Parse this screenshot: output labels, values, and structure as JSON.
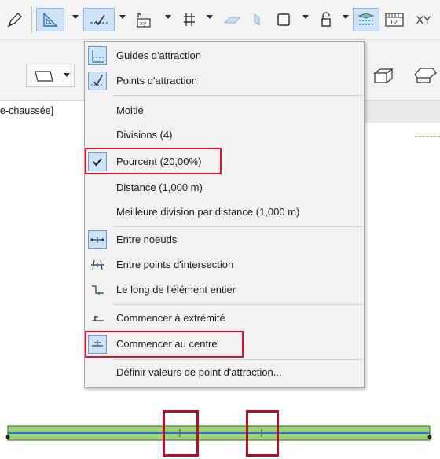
{
  "story_label": "e-chaussée]",
  "menu": {
    "items": [
      {
        "label": "Guides d'attraction",
        "icon": "attraction-guides-icon"
      },
      {
        "label": "Points d'attraction",
        "icon": "attraction-points-icon"
      },
      {
        "label": "Moitié"
      },
      {
        "label": "Divisions (4)"
      },
      {
        "label": "Pourcent (20,00%)",
        "checked": true
      },
      {
        "label": "Distance (1,000 m)"
      },
      {
        "label": "Meilleure division par distance (1,000 m)"
      },
      {
        "label": "Entre noeuds",
        "icon": "between-nodes-icon"
      },
      {
        "label": "Entre points d'intersection",
        "icon": "between-intersections-icon"
      },
      {
        "label": "Le long de l'élément entier",
        "icon": "along-element-icon"
      },
      {
        "label": "Commencer à extrémité",
        "icon": "start-at-end-icon"
      },
      {
        "label": "Commencer au centre",
        "icon": "start-at-center-icon",
        "selected": true
      },
      {
        "label": "Définir valeurs de point d'attraction..."
      }
    ]
  },
  "toolbar": {
    "coord_label": "12",
    "xy_label": "XY"
  },
  "colors": {
    "highlight_red": "#e0102a",
    "beam_fill": "#9fd27a",
    "beam_line": "#1f7bc4",
    "active_blue": "#cfe3f6"
  }
}
